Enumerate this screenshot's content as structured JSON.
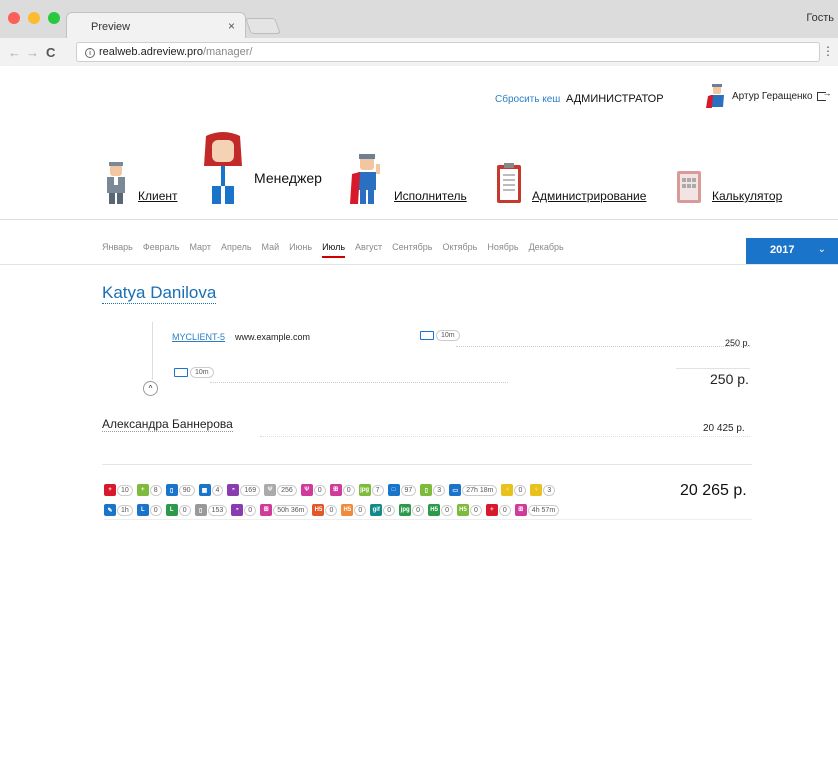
{
  "browser": {
    "tab_title": "Preview",
    "tab_close": "×",
    "guest": "Гость",
    "url_host": "realweb.adreview.pro",
    "url_path": "/manager/",
    "back": "←",
    "forward": "→",
    "reload": "C",
    "menu": "⋮"
  },
  "header": {
    "reset_cache": "Сбросить кеш",
    "role": "АДМИНИСТРАТОР",
    "user_name": "Артур Геращенко"
  },
  "roles": [
    {
      "label": "Клиент"
    },
    {
      "label": "Менеджер"
    },
    {
      "label": "Исполнитель"
    },
    {
      "label": "Администрирование"
    },
    {
      "label": "Калькулятор"
    }
  ],
  "months": [
    "Январь",
    "Февраль",
    "Март",
    "Апрель",
    "Май",
    "Июнь",
    "Июль",
    "Август",
    "Сентябрь",
    "Октябрь",
    "Ноябрь",
    "Декабрь"
  ],
  "active_month": "Июль",
  "year": "2017",
  "year_chevron": "⌄",
  "manager": {
    "name": "Katya Danilova",
    "client_id": "MYCLIENT-5",
    "client_site": "www.example.com",
    "client_time": "10m",
    "client_price": "250 р.",
    "sub_time": "10m",
    "subtotal": "250 р.",
    "collapse": "^"
  },
  "manager2": {
    "name": "Александра Баннерова",
    "price": "20 425 р."
  },
  "stats_row1": [
    {
      "icon": "medical-cross-icon",
      "color": "#d8192b",
      "glyph": "+",
      "value": "10"
    },
    {
      "icon": "green-cross-icon",
      "color": "#7dbb3c",
      "glyph": "+",
      "value": "8"
    },
    {
      "icon": "mobile-layout-icon",
      "color": "#1a74c9",
      "glyph": "▯",
      "value": "90"
    },
    {
      "icon": "grid-icon",
      "color": "#1a74c9",
      "glyph": "▦",
      "value": "4"
    },
    {
      "icon": "dome-icon",
      "color": "#8a3bb0",
      "glyph": "◓",
      "value": "169"
    },
    {
      "icon": "tools-icon",
      "color": "#aaaaaa",
      "glyph": "Ψ",
      "value": "256"
    },
    {
      "icon": "tools-pink-icon",
      "color": "#d03a9a",
      "glyph": "Ψ",
      "value": "0"
    },
    {
      "icon": "people-icon",
      "color": "#d03a9a",
      "glyph": "ꕥ",
      "value": "0"
    },
    {
      "icon": "jpg-icon",
      "color": "#7dbb3c",
      "glyph": "jpg",
      "value": "7"
    },
    {
      "icon": "desktop-icon",
      "color": "#1a74c9",
      "glyph": "□",
      "value": "97"
    },
    {
      "icon": "layout-green-icon",
      "color": "#7dbb3c",
      "glyph": "▯",
      "value": "3"
    },
    {
      "icon": "tv-icon",
      "color": "#1a74c9",
      "glyph": "▭",
      "value": "27h 18m"
    },
    {
      "icon": "bulb-icon",
      "color": "#e8c21a",
      "glyph": "♀",
      "value": "0"
    },
    {
      "icon": "bulb-purple-icon",
      "color": "#e8c21a",
      "glyph": "♀",
      "value": "3"
    }
  ],
  "stats_row2": [
    {
      "icon": "pencil-icon",
      "color": "#1a74c9",
      "glyph": "✎",
      "value": "1h"
    },
    {
      "icon": "l-blue-icon",
      "color": "#1a74c9",
      "glyph": "L",
      "value": "0"
    },
    {
      "icon": "l-green-icon",
      "color": "#2c9a4a",
      "glyph": "L",
      "value": "0"
    },
    {
      "icon": "layout-gray-icon",
      "color": "#999999",
      "glyph": "▯",
      "value": "153"
    },
    {
      "icon": "dome-purple-icon",
      "color": "#8a3bb0",
      "glyph": "◓",
      "value": "0"
    },
    {
      "icon": "people-pink-icon",
      "color": "#d03a9a",
      "glyph": "ꕥ",
      "value": "50h 36m"
    },
    {
      "icon": "html5-icon",
      "color": "#e3572a",
      "glyph": "H5",
      "value": "0"
    },
    {
      "icon": "html5-lite-icon",
      "color": "#f08b3c",
      "glyph": "H5",
      "value": "0"
    },
    {
      "icon": "gif-icon",
      "color": "#138a8a",
      "glyph": "gif",
      "value": "0"
    },
    {
      "icon": "jpg-teal-icon",
      "color": "#2c9a4a",
      "glyph": "jpg",
      "value": "0"
    },
    {
      "icon": "h5-green-icon",
      "color": "#2c9a4a",
      "glyph": "H5",
      "value": "0"
    },
    {
      "icon": "h5-lightgreen-icon",
      "color": "#7dbb3c",
      "glyph": "H5",
      "value": "0"
    },
    {
      "icon": "medical-cross-red-icon",
      "color": "#d8192b",
      "glyph": "+",
      "value": "0"
    },
    {
      "icon": "people-magenta-icon",
      "color": "#d03a9a",
      "glyph": "ꕥ",
      "value": "4h 57m"
    }
  ],
  "total": "20 265 р."
}
